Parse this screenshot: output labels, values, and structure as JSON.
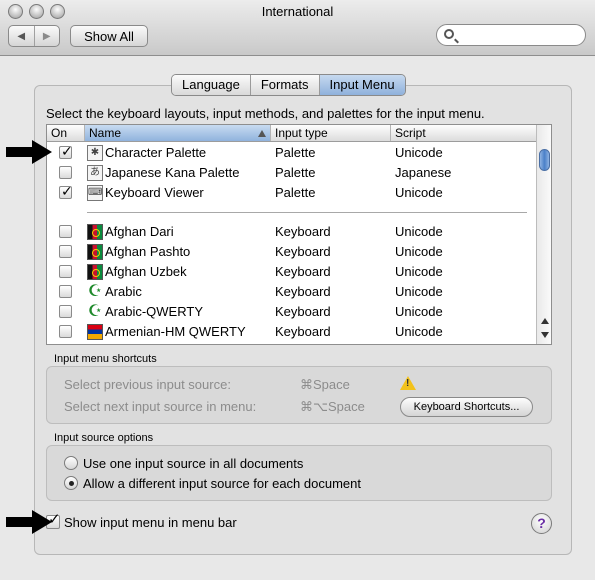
{
  "window": {
    "title": "International"
  },
  "toolbar": {
    "show_all": "Show All",
    "back_icon": "back-icon",
    "forward_icon": "forward-icon",
    "search_placeholder": ""
  },
  "tabs": [
    {
      "label": "Language",
      "active": false
    },
    {
      "label": "Formats",
      "active": false
    },
    {
      "label": "Input Menu",
      "active": true
    }
  ],
  "intro": "Select the keyboard layouts, input methods, and palettes for the input menu.",
  "table": {
    "headers": {
      "on": "On",
      "name": "Name",
      "type": "Input type",
      "script": "Script"
    },
    "rows": [
      {
        "checked": true,
        "icon": "character-palette-icon",
        "name": "Character Palette",
        "type": "Palette",
        "script": "Unicode"
      },
      {
        "checked": false,
        "icon": "kana-palette-icon",
        "name": "Japanese Kana Palette",
        "type": "Palette",
        "script": "Japanese"
      },
      {
        "checked": true,
        "icon": "keyboard-viewer-icon",
        "name": "Keyboard Viewer",
        "type": "Palette",
        "script": "Unicode"
      },
      {
        "checked": false,
        "icon": "afghanistan-flag-icon",
        "name": "Afghan Dari",
        "type": "Keyboard",
        "script": "Unicode"
      },
      {
        "checked": false,
        "icon": "afghanistan-flag-icon",
        "name": "Afghan Pashto",
        "type": "Keyboard",
        "script": "Unicode"
      },
      {
        "checked": false,
        "icon": "afghanistan-flag-icon",
        "name": "Afghan Uzbek",
        "type": "Keyboard",
        "script": "Unicode"
      },
      {
        "checked": false,
        "icon": "crescent-icon",
        "name": "Arabic",
        "type": "Keyboard",
        "script": "Unicode"
      },
      {
        "checked": false,
        "icon": "crescent-icon",
        "name": "Arabic-QWERTY",
        "type": "Keyboard",
        "script": "Unicode"
      },
      {
        "checked": false,
        "icon": "armenia-flag-icon",
        "name": "Armenian-HM QWERTY",
        "type": "Keyboard",
        "script": "Unicode"
      }
    ]
  },
  "shortcuts": {
    "title": "Input menu shortcuts",
    "prev_label": "Select previous input source:",
    "prev_key": "⌘Space",
    "next_label": "Select next input source in menu:",
    "next_key": "⌘⌥Space",
    "button": "Keyboard Shortcuts..."
  },
  "options": {
    "title": "Input source options",
    "radio1": "Use one input source in all documents",
    "radio2": "Allow a different input source for each document",
    "selected": 2
  },
  "show_in_menu_bar": {
    "label": "Show input menu in menu bar",
    "checked": true
  },
  "help": "?"
}
